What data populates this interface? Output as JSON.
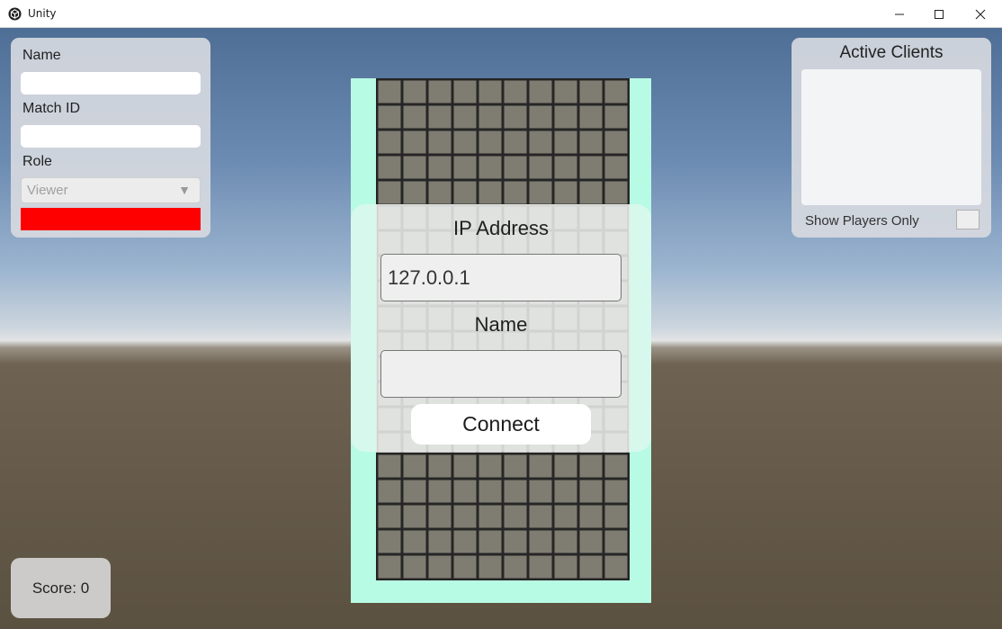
{
  "window": {
    "title": "Unity",
    "controls": [
      "minimize-icon",
      "maximize-icon",
      "close-icon"
    ]
  },
  "left_panel": {
    "name_label": "Name",
    "name_value": "",
    "match_id_label": "Match ID",
    "match_id_value": "",
    "role_label": "Role",
    "role_selected": "Viewer",
    "color_indicator": "#ff0000"
  },
  "connect_dialog": {
    "ip_label": "IP Address",
    "ip_value": "127.0.0.1",
    "name_label": "Name",
    "name_value": "",
    "connect_label": "Connect"
  },
  "right_panel": {
    "title": "Active Clients",
    "clients": [],
    "show_players_label": "Show Players Only",
    "show_players_checked": false
  },
  "score": {
    "text": "Score: 0"
  },
  "colors": {
    "board_border": "#b8fbe5",
    "cell": "#7f7c72",
    "accent_red": "#ff0000"
  }
}
